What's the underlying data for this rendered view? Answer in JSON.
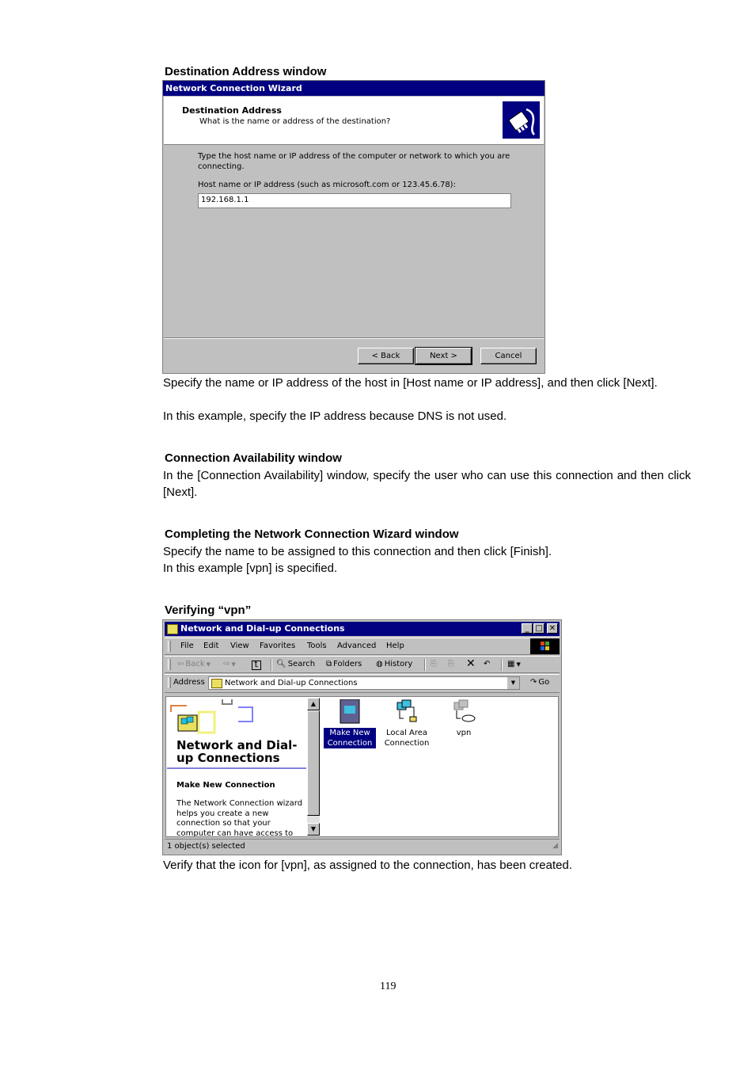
{
  "section1": {
    "heading": "Destination Address window",
    "wizard": {
      "title": "Network Connection Wizard",
      "header_title": "Destination Address",
      "header_subtitle": "What is the name or address of the destination?",
      "icon": "network-plug-icon",
      "instruction_line1": "Type the host name or IP address of the computer or network to which you are",
      "instruction_line2": "connecting.",
      "field_label": "Host name or IP address (such as microsoft.com or 123.45.6.78):",
      "field_value": "192.168.1.1",
      "back_label": "< Back",
      "next_label": "Next >",
      "cancel_label": "Cancel"
    },
    "para1": "Specify the name or IP address of the host in [Host name or IP address], and then click [Next].",
    "para2": "In this example, specify the IP address because DNS is not used."
  },
  "section2": {
    "heading": "Connection Availability window",
    "para1": "In the [Connection Availability] window, specify the user who can use this connection and then click [Next]."
  },
  "section3": {
    "heading": "Completing the Network Connection Wizard window",
    "para1": "Specify the name to be assigned to this connection and then click [Finish].",
    "para2": "In this example [vpn] is specified."
  },
  "section4": {
    "heading": "Verifying “vpn”",
    "explorer": {
      "title": "Network and Dial-up Connections",
      "menu": [
        "File",
        "Edit",
        "View",
        "Favorites",
        "Tools",
        "Advanced",
        "Help"
      ],
      "toolbar": {
        "back": "Back",
        "search": "Search",
        "folders": "Folders",
        "history": "History"
      },
      "address_label": "Address",
      "address_value": "Network and Dial-up Connections",
      "go_label": "Go",
      "left_pane": {
        "title": "Network and Dial-up Connections",
        "subtitle": "Make New Connection",
        "description": "The Network Connection wizard helps you create a new connection so that your computer can have access to other computers and"
      },
      "items": [
        {
          "label": "Make New Connection",
          "icon": "make-new-connection-icon",
          "selected": true
        },
        {
          "label": "Local Area Connection",
          "icon": "local-area-connection-icon",
          "selected": false
        },
        {
          "label": "vpn",
          "icon": "vpn-connection-icon",
          "selected": false
        }
      ],
      "status": "1 object(s) selected"
    },
    "para1": "Verify that the icon for [vpn], as assigned to the connection, has been created."
  },
  "page_number": "119"
}
